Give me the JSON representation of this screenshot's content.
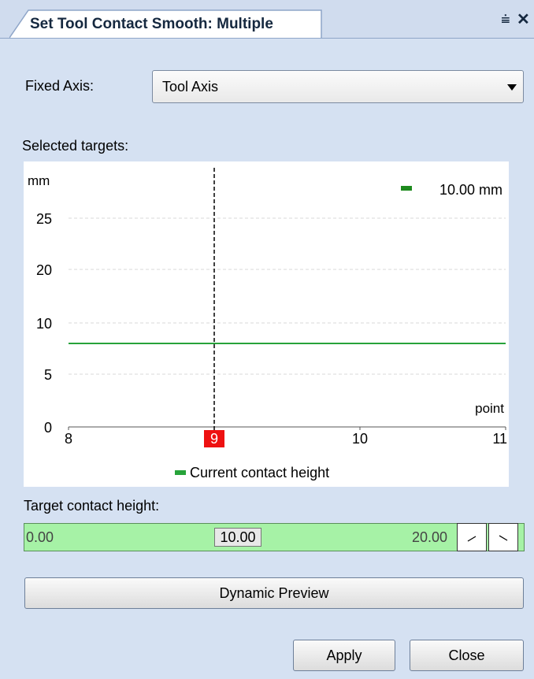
{
  "window": {
    "tab_title": "Set Tool Contact Smooth: Multiple",
    "pin_glyph": "⩧",
    "close_glyph": "✕"
  },
  "fixed_axis": {
    "label": "Fixed Axis:",
    "value": "Tool Axis"
  },
  "selected_targets_label": "Selected targets:",
  "chart_data": {
    "type": "line",
    "ylabel": "mm",
    "xlabel": "point",
    "x_ticks": [
      "8",
      "9",
      "10",
      "11"
    ],
    "y_ticks": [
      "0",
      "5",
      "10",
      "20",
      "25"
    ],
    "highlighted_x_tick": "9",
    "series": [
      {
        "name": "Current contact height",
        "x": [
          8,
          11
        ],
        "y": [
          8,
          8
        ],
        "color": "#27a33a"
      }
    ],
    "legend_value": "10.00 mm",
    "legend_color": "#1e8a1e",
    "marker_line_x": 9,
    "grid": true
  },
  "target_height": {
    "label": "Target contact height:",
    "min": "0.00",
    "value": "10.00",
    "max": "20.00",
    "increase_icon": "increase-slope-icon",
    "decrease_icon": "decrease-slope-icon"
  },
  "buttons": {
    "preview": "Dynamic Preview",
    "apply": "Apply",
    "close": "Close"
  }
}
